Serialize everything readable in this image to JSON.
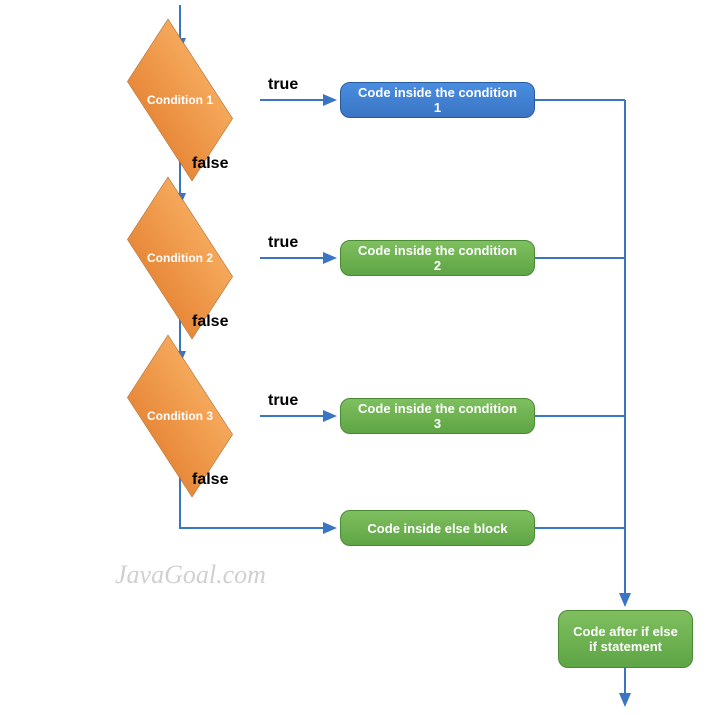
{
  "chart_data": {
    "type": "flowchart",
    "title": "",
    "nodes": [
      {
        "id": "cond1",
        "type": "decision",
        "label": "Condition 1"
      },
      {
        "id": "cond2",
        "type": "decision",
        "label": "Condition 2"
      },
      {
        "id": "cond3",
        "type": "decision",
        "label": "Condition 3"
      },
      {
        "id": "code1",
        "type": "process",
        "label": "Code inside the condition 1",
        "color": "blue"
      },
      {
        "id": "code2",
        "type": "process",
        "label": "Code inside the condition 2",
        "color": "green"
      },
      {
        "id": "code3",
        "type": "process",
        "label": "Code inside the condition 3",
        "color": "green"
      },
      {
        "id": "codeelse",
        "type": "process",
        "label": "Code inside else block",
        "color": "green"
      },
      {
        "id": "after",
        "type": "process",
        "label": "Code after if else if statement",
        "color": "green"
      }
    ],
    "edges": [
      {
        "from": "start",
        "to": "cond1"
      },
      {
        "from": "cond1",
        "to": "code1",
        "label": "true"
      },
      {
        "from": "cond1",
        "to": "cond2",
        "label": "false"
      },
      {
        "from": "cond2",
        "to": "code2",
        "label": "true"
      },
      {
        "from": "cond2",
        "to": "cond3",
        "label": "false"
      },
      {
        "from": "cond3",
        "to": "code3",
        "label": "true"
      },
      {
        "from": "cond3",
        "to": "codeelse",
        "label": "false"
      },
      {
        "from": "code1",
        "to": "after"
      },
      {
        "from": "code2",
        "to": "after"
      },
      {
        "from": "code3",
        "to": "after"
      },
      {
        "from": "codeelse",
        "to": "after"
      },
      {
        "from": "after",
        "to": "end"
      }
    ]
  },
  "labels": {
    "true1": "true",
    "false1": "false",
    "true2": "true",
    "false2": "false",
    "true3": "true",
    "false3": "false"
  },
  "nodes": {
    "cond1": "Condition 1",
    "cond2": "Condition 2",
    "cond3": "Condition 3",
    "code1": "Code inside the condition 1",
    "code2": "Code inside the condition 2",
    "code3": "Code inside the condition 3",
    "codeelse": "Code inside else block",
    "after": "Code after if else if statement"
  },
  "watermark": "JavaGoal.com"
}
